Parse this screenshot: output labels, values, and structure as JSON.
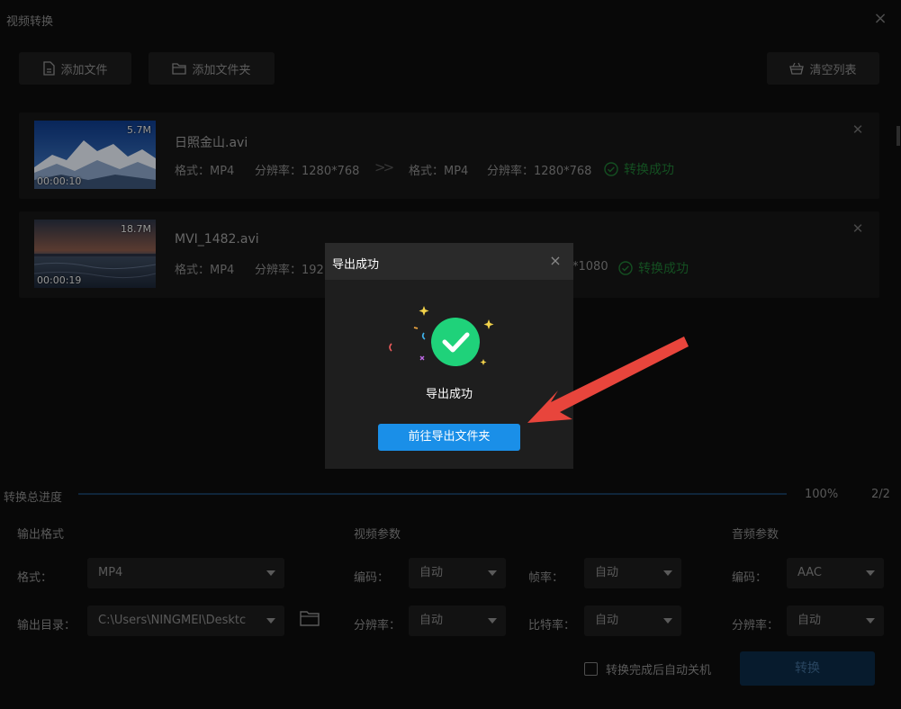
{
  "window": {
    "title": "视频转换",
    "close_glyph": "×"
  },
  "toolbar": {
    "add_file_label": "添加文件",
    "add_folder_label": "添加文件夹",
    "clear_list_label": "清空列表"
  },
  "files": [
    {
      "name": "日照金山.avi",
      "size": "5.7M",
      "duration": "00:00:10",
      "src_format": "格式：MP4",
      "src_resolution": "分辨率：1280*768",
      "arrows": ">>",
      "dst_format": "格式：MP4",
      "dst_resolution": "分辨率：1280*768",
      "status": "转换成功"
    },
    {
      "name": "MVI_1482.avi",
      "size": "18.7M",
      "duration": "00:00:19",
      "src_format": "格式：MP4",
      "src_resolution": "分辨率：192",
      "dst_resolution_tail": "*1080",
      "status": "转换成功"
    }
  ],
  "progress": {
    "label": "转换总进度",
    "percent_text": "100%",
    "percent": 100,
    "count": "2/2"
  },
  "output": {
    "section_title": "输出格式",
    "format_label": "格式：",
    "format_value": "MP4",
    "dir_label": "输出目录：",
    "dir_value": "C:\\Users\\NINGMEI\\Desktc"
  },
  "video": {
    "section_title": "视频参数",
    "codec_label": "编码：",
    "codec_value": "自动",
    "framerate_label": "帧率：",
    "framerate_value": "自动",
    "resolution_label": "分辨率：",
    "resolution_value": "自动",
    "bitrate_label": "比特率：",
    "bitrate_value": "自动"
  },
  "audio": {
    "section_title": "音频参数",
    "codec_label": "编码：",
    "codec_value": "AAC",
    "resolution_label": "分辨率：",
    "resolution_value": "自动"
  },
  "footer": {
    "auto_shutdown_label": "转换完成后自动关机",
    "auto_shutdown_checked": false,
    "convert_label": "转换"
  },
  "dialog": {
    "title": "导出成功",
    "message": "导出成功",
    "button_label": "前往导出文件夹",
    "close_glyph": "×"
  },
  "colors": {
    "success_green": "#1f7a34",
    "dialog_check": "#1fd27a",
    "primary_blue": "#1a8fe8",
    "annotation_red": "#e8453c"
  },
  "icons": {
    "add_file": "file-icon",
    "add_folder": "folder-icon",
    "clear_list": "basket-icon",
    "status": "check-circle-icon",
    "dialog": "success-check-icon",
    "browse": "folder-open-icon"
  }
}
